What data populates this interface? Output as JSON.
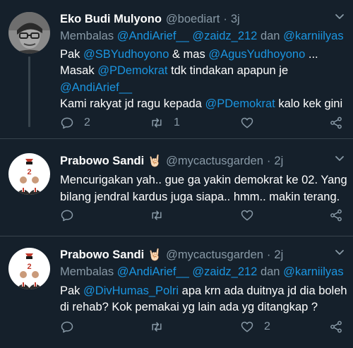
{
  "tweets": [
    {
      "name": "Eko Budi Mulyono",
      "emoji": "",
      "handle": "@boediart",
      "time": "3j",
      "reply_prefix": "Membalas",
      "reply_to": [
        "@AndiArief__",
        "@zaidz_212",
        "@karniilyas"
      ],
      "reply_and": "dan",
      "lines": {
        "l1_a": "Pak",
        "l1_m1": "@SBYudhoyono",
        "l1_b": "& mas",
        "l1_m2": "@AgusYudhoyono",
        "l1_c": "...",
        "l2_a": "Masak",
        "l2_m1": "@PDemokrat",
        "l2_b": "tdk tindakan apapun je",
        "l3_m1": "@AndiArief__",
        "l4_a": "Kami rakyat jd ragu kepada",
        "l4_m1": "@PDemokrat",
        "l4_b": "kalo kek gini"
      },
      "replies": "2",
      "retweets": "1",
      "likes": ""
    },
    {
      "name": "Prabowo Sandi",
      "emoji": "🤘🏻",
      "handle": "@mycactusgarden",
      "time": "2j",
      "lines": {
        "l1": "Mencurigakan yah.. gue ga yakin demokrat ke 02. Yang",
        "l2": "bilang jendral kardus juga siapa.. hmm.. makin terang."
      },
      "replies": "",
      "retweets": "",
      "likes": ""
    },
    {
      "name": "Prabowo Sandi",
      "emoji": "🤘🏻",
      "handle": "@mycactusgarden",
      "time": "2j",
      "reply_prefix": "Membalas",
      "reply_to": [
        "@AndiArief__",
        "@zaidz_212",
        "@karniilyas"
      ],
      "reply_and": "dan",
      "lines": {
        "l1_a": "Pak",
        "l1_m1": "@DivHumas_Polri",
        "l1_b": "apa krn ada duitnya jd dia boleh",
        "l2": "di rehab? Kok pemakai yg lain ada yg ditangkap ?"
      },
      "replies": "",
      "retweets": "",
      "likes": "2"
    }
  ],
  "avatar_badge": "2",
  "colors": {
    "background": "#15202b",
    "text": "#ffffff",
    "muted": "#8899a6",
    "link": "#1b95e0",
    "divider": "#38444d"
  },
  "icons": [
    "reply-icon",
    "retweet-icon",
    "like-icon",
    "share-icon",
    "caret-down-icon"
  ]
}
